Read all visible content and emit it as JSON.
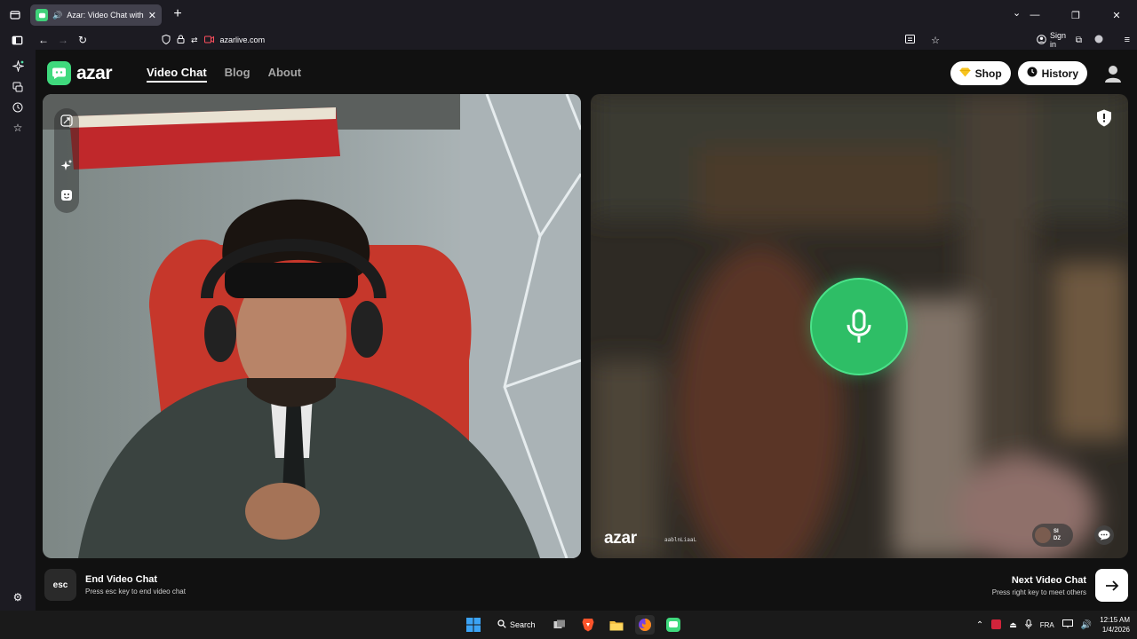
{
  "browser": {
    "tab_title": "Azar: Video Chat with New",
    "url": "azarlive.com",
    "sign_in": "Sign in"
  },
  "site": {
    "logo_text": "azar",
    "nav": [
      "Video Chat",
      "Blog",
      "About"
    ],
    "shop_label": "Shop",
    "history_label": "History"
  },
  "partner": {
    "watermark": "azar",
    "username": "aablnLiaaL",
    "country_top": "SI",
    "country_bottom": "DZ"
  },
  "footer": {
    "esc_key": "esc",
    "end_title": "End Video Chat",
    "end_sub": "Press esc key to end video chat",
    "next_title": "Next Video Chat",
    "next_sub": "Press right key to meet others"
  },
  "taskbar": {
    "search_label": "Search",
    "lang": "FRA",
    "time": "12:15 AM",
    "date": "1/4/2026"
  },
  "colors": {
    "brand_green": "#3fd97d",
    "mic_green": "#2ebe66"
  }
}
